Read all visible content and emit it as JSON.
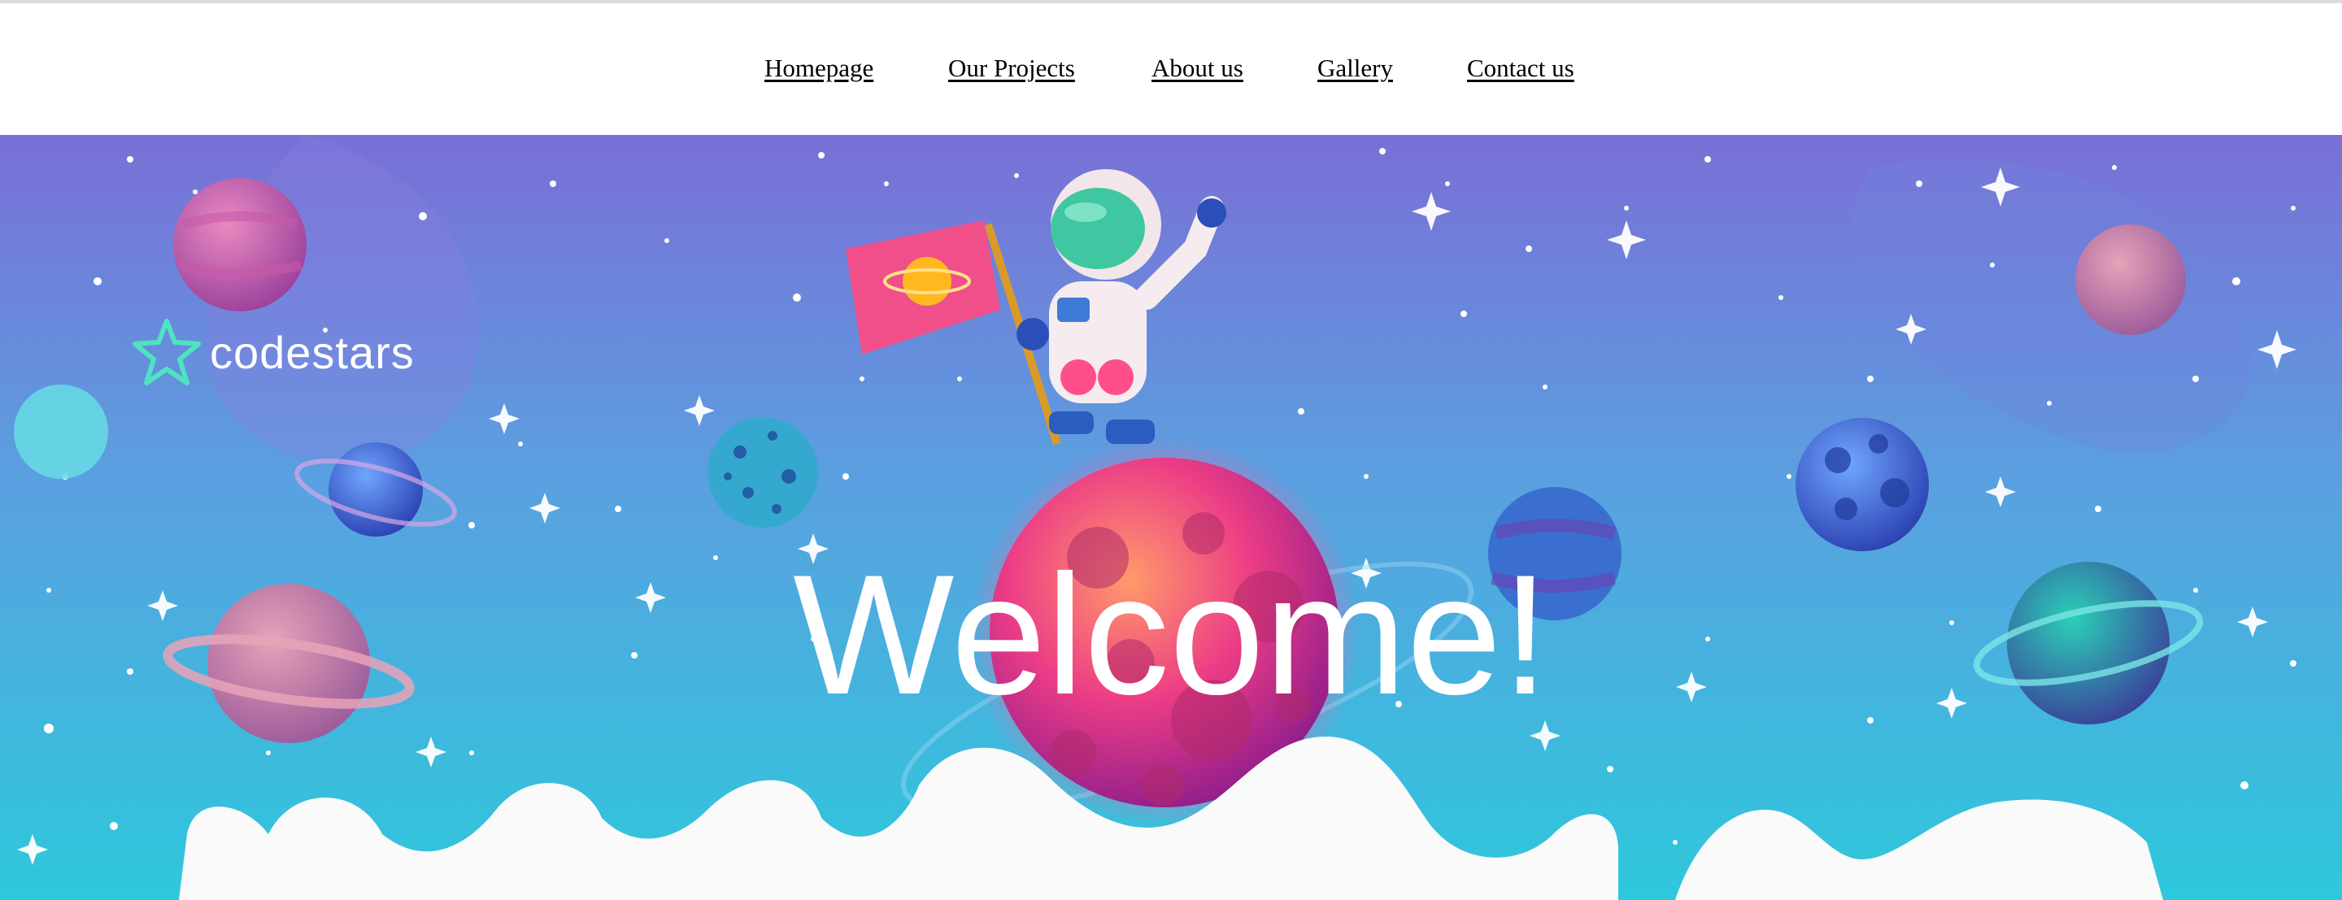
{
  "nav": {
    "items": [
      {
        "label": "Homepage"
      },
      {
        "label": "Our Projects"
      },
      {
        "label": "About us"
      },
      {
        "label": "Gallery"
      },
      {
        "label": "Contact us"
      }
    ]
  },
  "hero": {
    "logo_text": "codestars",
    "headline": "Welcome!",
    "colors": {
      "sky_top": "#7a6fd6",
      "sky_bottom": "#2ec8dc",
      "cloud": "#fafafa",
      "logo_accent": "#4fe3c1"
    },
    "icons": [
      "codestars-star-logo-icon",
      "astronaut-illustration",
      "flag-icon"
    ]
  }
}
